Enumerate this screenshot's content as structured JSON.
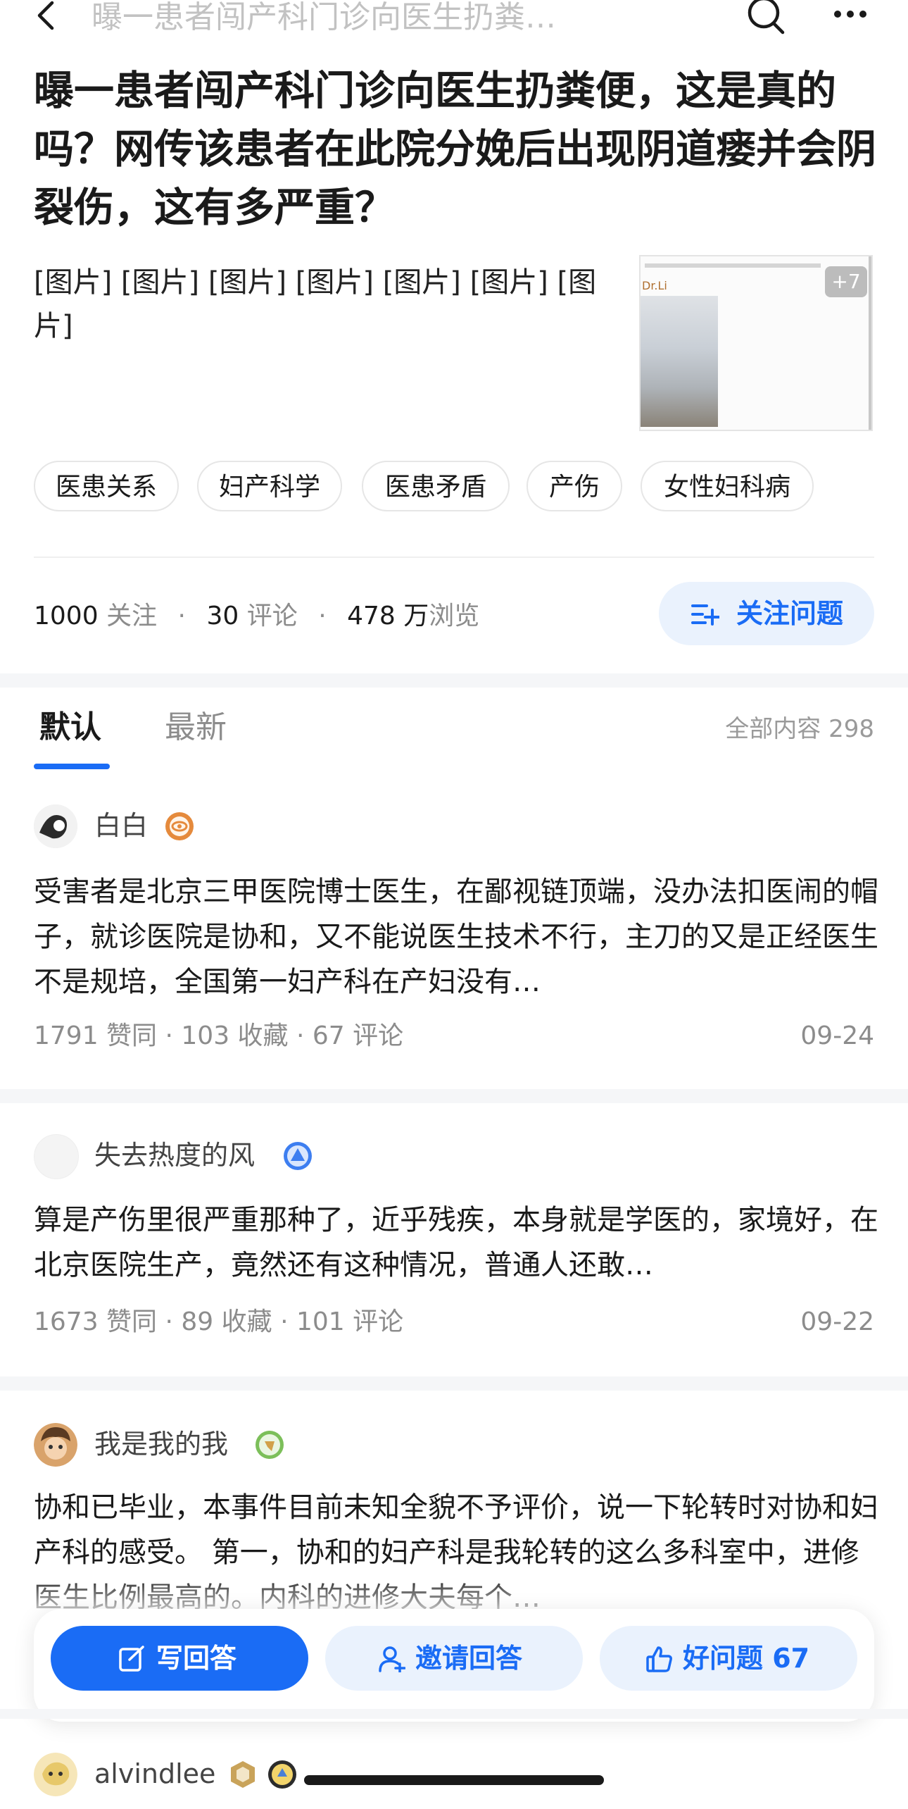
{
  "topbar": {
    "title": "曝一患者闯产科门诊向医生扔粪…"
  },
  "question": {
    "title": "曝一患者闯产科门诊向医生扔粪便，这是真的吗？网传该患者在此院分娩后出现阴道瘘并会阴裂伤，这有多严重？",
    "description": "[图片] [图片] [图片] [图片] [图片] [图片] [图片]",
    "thumb_badge": "+7",
    "thumb_caption": "Dr.Li"
  },
  "tags": [
    "医患关系",
    "妇产科学",
    "医患矛盾",
    "产伤",
    "女性妇科病"
  ],
  "stats": {
    "follow_count": "1000",
    "follow_label": "关注",
    "comment_count": "30",
    "comment_label": "评论",
    "view_count": "478 万",
    "view_label": "浏览",
    "sep": "·"
  },
  "follow_button": "关注问题",
  "tabs": {
    "default": "默认",
    "latest": "最新",
    "all_count": "全部内容 298"
  },
  "answers": [
    {
      "author": "白白",
      "text": "受害者是北京三甲医院博士医生，在鄙视链顶端，没办法扣医闹的帽子，就诊医院是协和，又不能说医生技术不行，主刀的又是正经医生不是规培，全国第一妇产科在产妇没有…",
      "meta": "1791 赞同 · 103 收藏 · 67 评论",
      "date": "09-24",
      "badge_color": "#e58a3c"
    },
    {
      "author": "失去热度的风",
      "text": "算是产伤里很严重那种了，近乎残疾，本身就是学医的，家境好，在北京医院生产，竟然还有这种情况，普通人还敢…",
      "meta": "1673 赞同 · 89 收藏 · 101 评论",
      "date": "09-22",
      "badge_color": "#3d7ef0"
    },
    {
      "author": "我是我的我",
      "text": "协和已毕业，本事件目前未知全貌不予评价，说一下轮转时对协和妇产科的感受。 第一，协和的妇产科是我轮转的这么多科室中，进修医生比例最高的。内科的进修大夫每个…",
      "badge_color": "#7cbf5a"
    },
    {
      "author": "alvindlee",
      "badge_color": "#c9a35a"
    }
  ],
  "bottom_bar": {
    "write": "写回答",
    "invite": "邀请回答",
    "good_question": "好问题 67"
  },
  "colors": {
    "accent": "#1a6cf5",
    "accent_light": "#eaf2fd",
    "muted_text": "#8c8c8c"
  },
  "icons": [
    "back-arrow-icon",
    "search-icon",
    "more-icon",
    "follow-add-icon",
    "edit-icon",
    "invite-user-icon",
    "thumbs-up-icon"
  ]
}
